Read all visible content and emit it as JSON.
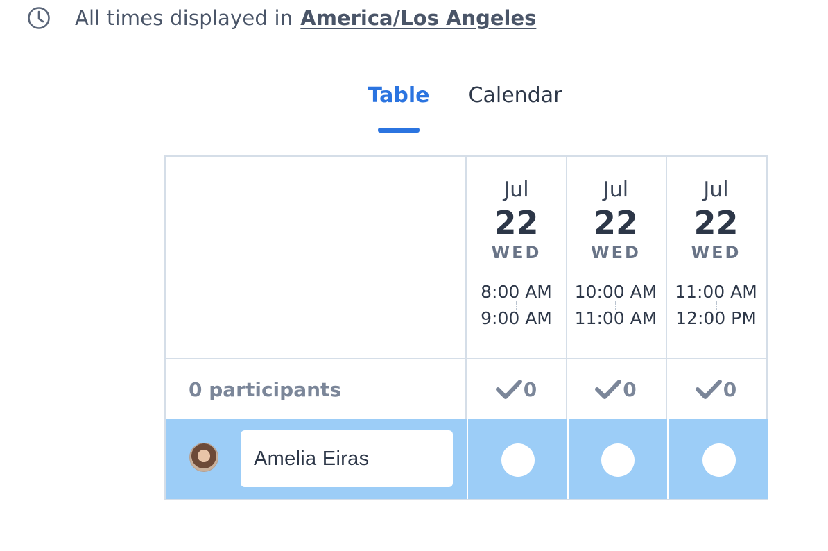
{
  "timezone_bar": {
    "prefix": "All times displayed in",
    "timezone": "America/Los Angeles",
    "icon": "clock-icon"
  },
  "tabs": [
    {
      "label": "Table",
      "active": true
    },
    {
      "label": "Calendar",
      "active": false
    }
  ],
  "colors": {
    "accent": "#2b74e0",
    "row_highlight": "#9ccdf7",
    "border": "#d5dee8",
    "muted_text": "#7b8699"
  },
  "options": [
    {
      "month": "Jul",
      "day": "22",
      "weekday": "WED",
      "start": "8:00 AM",
      "end": "9:00 AM",
      "count": "0"
    },
    {
      "month": "Jul",
      "day": "22",
      "weekday": "WED",
      "start": "10:00 AM",
      "end": "11:00 AM",
      "count": "0"
    },
    {
      "month": "Jul",
      "day": "22",
      "weekday": "WED",
      "start": "11:00 AM",
      "end": "12:00 PM",
      "count": "0"
    }
  ],
  "participants_label": "0 participants",
  "current_user": {
    "name": "Amelia Eiras",
    "avatar": "avatar-photo"
  }
}
